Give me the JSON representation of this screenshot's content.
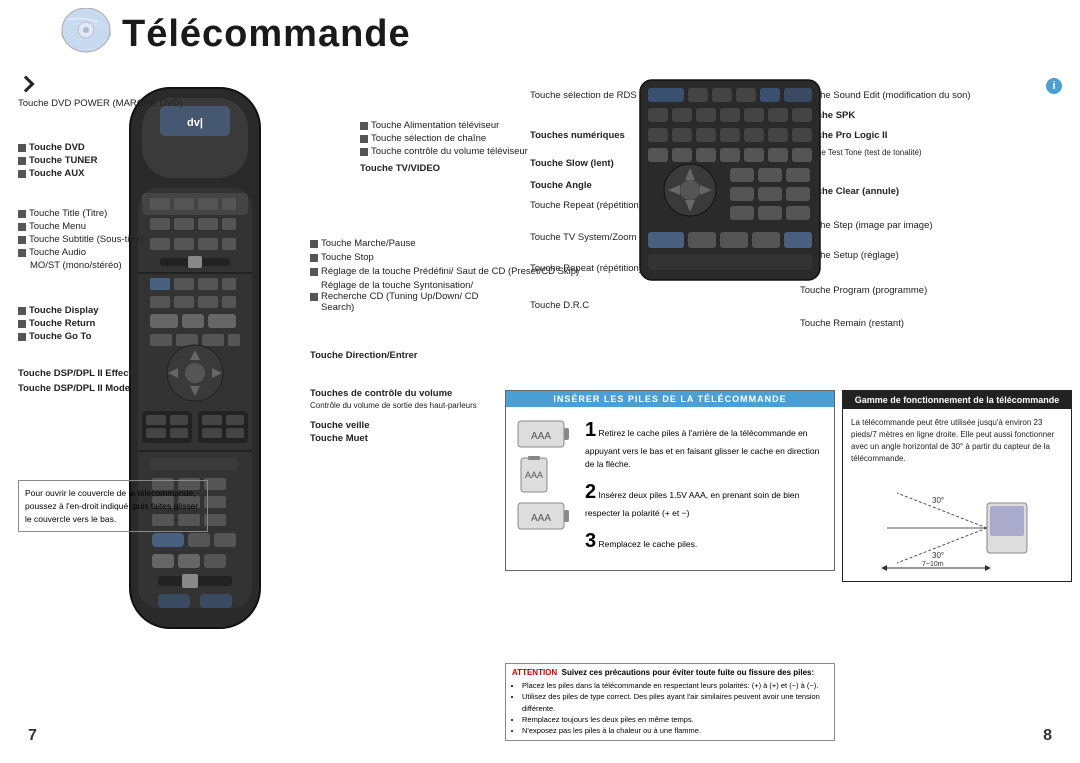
{
  "page": {
    "title": "Télécommande",
    "page_left": "7",
    "page_right": "8"
  },
  "left_labels": {
    "dvd_power": "Touche DVD POWER (MARCHE DVD)",
    "dvd": "Touche DVD",
    "tuner": "Touche TUNER",
    "aux": "Touche AUX",
    "title": "Touche Title (Titre)",
    "menu": "Touche Menu",
    "subtitle": "Touche Subtitle (Sous-titre)",
    "audio": "Touche Audio",
    "audio_sub": "MO/ST (mono/stéréo)",
    "display": "Touche Display",
    "return": "Touche Return",
    "goto": "Touche Go To",
    "dsp_effect": "Touche DSP/DPL II Effect",
    "dsp_mode": "Touche DSP/DPL II Mode",
    "open_cover": "Pour ouvrir le couvercle de la télécommande, poussez à l'en-droit indiqué, puis faites glisser le couvercle vers le bas.",
    "tv_power": "Touche Alimentation téléviseur",
    "tv_chan": "Touche sélection de chaîne",
    "tv_vol": "Touche contrôle du volume téléviseur",
    "tv_video": "Touche TV/VIDEO",
    "play_pause": "Touche Marche/Pause",
    "stop": "Touche Stop",
    "preset": "Réglage de la touche Prédéfini/ Saut de CD (Preset/CD Skip)",
    "tuning": "Réglage de la touche Syntonisation/ Recherche CD (Tuning Up/Down/ CD Search)",
    "direction": "Touche Direction/Entrer",
    "volume_ctrl": "Touches de contrôle du volume",
    "volume_sub": "Contrôle du volume de sortie des haut-parleurs",
    "veille": "Touche veille",
    "mute": "Touche Muet"
  },
  "right_labels": {
    "rds": "Touche sélection de RDS",
    "numeric": "Touches numériques",
    "slow": "Touche Slow (lent)",
    "angle": "Touche Angle",
    "repeat": "Touche Repeat (répétition)",
    "tv_zoom": "Touche TV System/Zoom",
    "repeat_ab": "Touche Repeat (répétition) A↔B",
    "drc": "Touche D.R.C",
    "sound_edit": "Touche Sound Edit (modification du son)",
    "spk": "Touche SPK",
    "pro_logic": "Touche Pro Logic II",
    "test_tone": "Touche Test Tone (test de tonalité)",
    "clear": "Touche Clear (annule)",
    "step": "Touche Step (image par image)",
    "setup": "Touche Setup (réglage)",
    "program": "Touche Program (programme)",
    "remain": "Touche Remain (restant)"
  },
  "battery": {
    "header": "INSÉRER LES PILES DE LA TÉLÉCOMMANDE",
    "step1_num": "1",
    "step1_text": "Retirez le cache piles à l'arrière de la télécommande en appuyant vers le bas et en faisant glisser le cache en direction de la flèche.",
    "step2_num": "2",
    "step2_text": "Insérez deux piles 1.5V AAA, en prenant soin de bien respecter la polarité (+ et −)",
    "step3_num": "3",
    "step3_text": "Remplacez le cache piles."
  },
  "gamme": {
    "header": "Gamme de fonctionnement de la télécommande",
    "text": "La télécommande peut être utilisée jusqu'à environ 23 pieds/7 mètres en ligne droite. Elle peut aussi fonctionner avec un angle horizontal de 30° à partir du capteur de la télécommande.",
    "angle_label": "30° 30°",
    "distance_label": "7~10m"
  },
  "attention": {
    "title": "ATTENTION",
    "header": "Suivez ces précautions pour éviter toute fuite ou fissure des piles:",
    "items": [
      "Placez les piles dans la télécommande en respectant leurs polarités: (+) à (+) et (−) à (−).",
      "Utilisez des piles de type correct. Des piles ayant l'air similaires peuvent avoir une tension différente.",
      "Remplacez toujours les deux piles en même temps.",
      "N'exposez pas les piles à la chaleur ou à une flamme."
    ]
  }
}
